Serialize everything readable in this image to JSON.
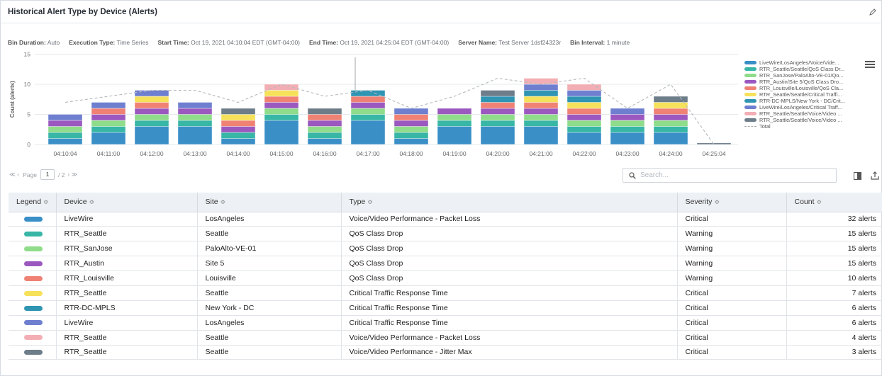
{
  "title": "Historical Alert Type by Device (Alerts)",
  "meta": [
    {
      "label": "Bin Duration:",
      "value": "Auto"
    },
    {
      "label": "Execution Type:",
      "value": "Time Series"
    },
    {
      "label": "Start Time:",
      "value": "Oct 19, 2021 04:10:04 EDT (GMT-04:00)"
    },
    {
      "label": "End Time:",
      "value": "Oct 19, 2021 04:25:04 EDT (GMT-04:00)"
    },
    {
      "label": "Server Name:",
      "value": "Test Server 1dsf24323r"
    },
    {
      "label": "Bin Interval:",
      "value": "1 minute"
    }
  ],
  "chart_data": {
    "type": "bar",
    "stacked": true,
    "ylabel": "Count (alerts)",
    "ylim": [
      0,
      15
    ],
    "yticks": [
      0,
      5,
      10,
      15
    ],
    "grid": true,
    "legend_position": "right",
    "categories": [
      "04:10:04",
      "04:11:00",
      "04:12:00",
      "04:13:00",
      "04:14:00",
      "04:15:00",
      "04:16:00",
      "04:17:00",
      "04:18:00",
      "04:19:00",
      "04:20:00",
      "04:21:00",
      "04:22:00",
      "04:23:00",
      "04:24:00",
      "04:25:04"
    ],
    "series": [
      {
        "name": "LiveWire/LosAngeles/Voice/Vide...",
        "color": "#3a8fc7",
        "values": [
          1,
          2,
          3,
          3,
          1,
          4,
          1,
          4,
          1,
          3,
          3,
          3,
          2,
          2,
          2,
          0
        ]
      },
      {
        "name": "RTR_Seattle/Seattle/QoS Class Dr...",
        "color": "#38b6a6",
        "values": [
          1,
          1,
          1,
          1,
          1,
          1,
          1,
          1,
          1,
          1,
          1,
          1,
          1,
          1,
          1,
          0
        ]
      },
      {
        "name": "RTR_SanJose/PaloAlto-VE-01/Qo...",
        "color": "#8fdc8a",
        "values": [
          1,
          1,
          1,
          1,
          0,
          1,
          1,
          1,
          1,
          1,
          1,
          1,
          1,
          1,
          1,
          0
        ]
      },
      {
        "name": "RTR_Austin/Site 5/QoS Class Dro...",
        "color": "#9b59c0",
        "values": [
          1,
          1,
          1,
          1,
          1,
          1,
          1,
          1,
          1,
          1,
          1,
          1,
          1,
          1,
          1,
          0
        ]
      },
      {
        "name": "RTR_Louisville/Louisville/QoS Cla...",
        "color": "#ef8275",
        "values": [
          0,
          1,
          1,
          0,
          1,
          1,
          1,
          1,
          1,
          0,
          1,
          1,
          1,
          0,
          1,
          0
        ]
      },
      {
        "name": "RTR_Seattle/Seattle/Critical Traffi...",
        "color": "#f6e15a",
        "values": [
          0,
          0,
          1,
          0,
          1,
          1,
          0,
          0,
          0,
          0,
          0,
          1,
          1,
          0,
          1,
          0
        ]
      },
      {
        "name": "RTR-DC-MPLS/New York - DC/Crit...",
        "color": "#2f95b3",
        "values": [
          0,
          0,
          0,
          0,
          0,
          0,
          0,
          1,
          0,
          0,
          1,
          1,
          1,
          0,
          0,
          0
        ]
      },
      {
        "name": "LiveWire/LosAngeles/Critical Traff...",
        "color": "#6f7fd0",
        "values": [
          1,
          1,
          1,
          1,
          0,
          0,
          0,
          0,
          1,
          0,
          0,
          1,
          1,
          1,
          0,
          0
        ]
      },
      {
        "name": "RTR_Seattle/Seattle/Voice/Video ...",
        "color": "#f2aeb4",
        "values": [
          0,
          0,
          0,
          0,
          0,
          1,
          0,
          0,
          0,
          0,
          0,
          1,
          1,
          0,
          0,
          0
        ]
      },
      {
        "name": "RTR_Seattle/Seattle/Voice/Video ...",
        "color": "#6d7d89",
        "values": [
          0,
          0,
          0,
          0,
          1,
          0,
          1,
          0,
          0,
          0,
          1,
          0,
          0,
          0,
          1,
          0.25
        ]
      }
    ],
    "total": {
      "name": "Total",
      "values": [
        7,
        8,
        9,
        9,
        7,
        10,
        8,
        9,
        6,
        8,
        11,
        10,
        11,
        6,
        10,
        0
      ]
    }
  },
  "pager": {
    "prev_label": "≪ ‹",
    "page_label": "Page",
    "current_page": "1",
    "of_label": "/ 2",
    "next_label": "› ≫"
  },
  "search": {
    "placeholder": "Search..."
  },
  "table": {
    "headers": [
      "Legend",
      "Device",
      "Site",
      "Type",
      "Severity",
      "Count"
    ],
    "sort_glyph": "≎",
    "rows": [
      {
        "color": "#3a8fc7",
        "device": "LiveWire",
        "site": "LosAngeles",
        "type": "Voice/Video Performance - Packet Loss",
        "severity": "Critical",
        "count": "32 alerts"
      },
      {
        "color": "#38b6a6",
        "device": "RTR_Seattle",
        "site": "Seattle",
        "type": "QoS Class Drop",
        "severity": "Warning",
        "count": "15 alerts"
      },
      {
        "color": "#8fdc8a",
        "device": "RTR_SanJose",
        "site": "PaloAlto-VE-01",
        "type": "QoS Class Drop",
        "severity": "Warning",
        "count": "15 alerts"
      },
      {
        "color": "#9b59c0",
        "device": "RTR_Austin",
        "site": "Site 5",
        "type": "QoS Class Drop",
        "severity": "Warning",
        "count": "15 alerts"
      },
      {
        "color": "#ef8275",
        "device": "RTR_Louisville",
        "site": "Louisville",
        "type": "QoS Class Drop",
        "severity": "Warning",
        "count": "10 alerts"
      },
      {
        "color": "#f6e15a",
        "device": "RTR_Seattle",
        "site": "Seattle",
        "type": "Critical Traffic Response Time",
        "severity": "Critical",
        "count": "7 alerts"
      },
      {
        "color": "#2f95b3",
        "device": "RTR-DC-MPLS",
        "site": "New York - DC",
        "type": "Critical Traffic Response Time",
        "severity": "Critical",
        "count": "6 alerts"
      },
      {
        "color": "#6f7fd0",
        "device": "LiveWire",
        "site": "LosAngeles",
        "type": "Critical Traffic Response Time",
        "severity": "Critical",
        "count": "6 alerts"
      },
      {
        "color": "#f2aeb4",
        "device": "RTR_Seattle",
        "site": "Seattle",
        "type": "Voice/Video Performance - Packet Loss",
        "severity": "Critical",
        "count": "4 alerts"
      },
      {
        "color": "#6d7d89",
        "device": "RTR_Seattle",
        "site": "Seattle",
        "type": "Voice/Video Performance - Jitter Max",
        "severity": "Critical",
        "count": "3 alerts"
      }
    ]
  }
}
